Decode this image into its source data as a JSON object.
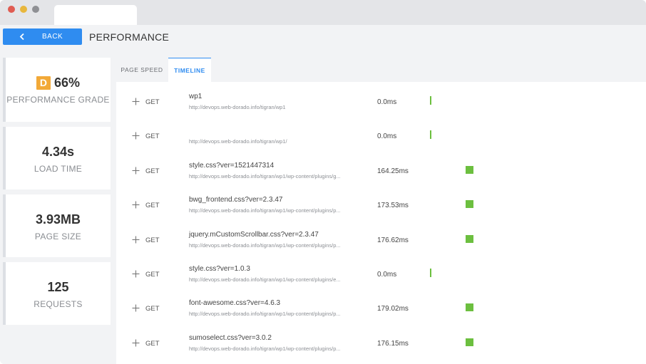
{
  "header": {
    "back_label": "BACK",
    "title": "PERFORMANCE"
  },
  "summary": {
    "grade": {
      "letter": "D",
      "value": "66%",
      "caption": "PERFORMANCE GRADE"
    },
    "load_time": {
      "value": "4.34s",
      "caption": "LOAD TIME"
    },
    "page_size": {
      "value": "3.93MB",
      "caption": "PAGE SIZE"
    },
    "requests": {
      "value": "125",
      "caption": "REQUESTS"
    }
  },
  "tabs": [
    {
      "label": "PAGE SPEED",
      "active": false
    },
    {
      "label": "TIMELINE",
      "active": true
    }
  ],
  "timeline": {
    "rows": [
      {
        "method": "GET",
        "name": "wp1",
        "url": "http://devops.web-dorado.info/tigran/wp1",
        "time": "0.0ms",
        "time_ms": 0.0
      },
      {
        "method": "GET",
        "name": "",
        "url": "http://devops.web-dorado.info/tigran/wp1/",
        "time": "0.0ms",
        "time_ms": 0.0
      },
      {
        "method": "GET",
        "name": "style.css?ver=1521447314",
        "url": "http://devops.web-dorado.info/tigran/wp1/wp-content/plugins/g...",
        "time": "164.25ms",
        "time_ms": 164.25
      },
      {
        "method": "GET",
        "name": "bwg_frontend.css?ver=2.3.47",
        "url": "http://devops.web-dorado.info/tigran/wp1/wp-content/plugins/p...",
        "time": "173.53ms",
        "time_ms": 173.53
      },
      {
        "method": "GET",
        "name": "jquery.mCustomScrollbar.css?ver=2.3.47",
        "url": "http://devops.web-dorado.info/tigran/wp1/wp-content/plugins/p...",
        "time": "176.62ms",
        "time_ms": 176.62
      },
      {
        "method": "GET",
        "name": "style.css?ver=1.0.3",
        "url": "http://devops.web-dorado.info/tigran/wp1/wp-content/plugins/e...",
        "time": "0.0ms",
        "time_ms": 0.0
      },
      {
        "method": "GET",
        "name": "font-awesome.css?ver=4.6.3",
        "url": "http://devops.web-dorado.info/tigran/wp1/wp-content/plugins/p...",
        "time": "179.02ms",
        "time_ms": 179.02
      },
      {
        "method": "GET",
        "name": "sumoselect.css?ver=3.0.2",
        "url": "http://devops.web-dorado.info/tigran/wp1/wp-content/plugins/p...",
        "time": "176.15ms",
        "time_ms": 176.15
      }
    ]
  },
  "colors": {
    "accent": "#2f8cf0",
    "grade_badge": "#f2a938",
    "timing_bar": "#6cbf3f"
  },
  "icons": {
    "back": "chevron-left-icon",
    "expand": "plus-icon"
  }
}
